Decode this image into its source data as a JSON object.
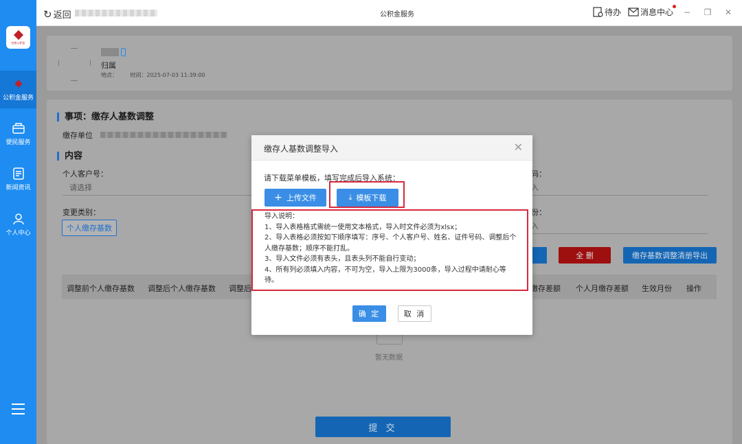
{
  "sidebar": {
    "logo_text": "住房公积金",
    "items": [
      {
        "label": "公积金服务",
        "icon": "diamond-logo-icon"
      },
      {
        "label": "便民服务",
        "icon": "box-icon"
      },
      {
        "label": "新闻资讯",
        "icon": "news-icon"
      },
      {
        "label": "个人中心",
        "icon": "user-icon"
      }
    ]
  },
  "topbar": {
    "back_label": "返回",
    "title": "公积金服务",
    "todo_label": "待办",
    "messages_label": "消息中心",
    "minimize": "−",
    "restore": "❐",
    "close": "✕"
  },
  "info_card": {
    "name": "归属",
    "location_label": "地点：",
    "time_label": "时间：2025-07-03 11:39:00"
  },
  "form": {
    "section_title": "事项：缴存人基数调整",
    "unit_label": "缴存单位",
    "content_title": "内容",
    "customer_no_label": "个人客户号：",
    "customer_no_placeholder": "请选择",
    "change_type_label": "变更类别：",
    "change_type_value": "个人缴存基数",
    "right_label_1": "码：",
    "right_value_1": "入",
    "right_label_2": "份：",
    "right_value_2": "入",
    "delete_all_label": "全 删",
    "export_label": "缴存基数调整清册导出",
    "table_headers": [
      "调整前个人缴存基数",
      "调整后个人缴存基数",
      "调整后",
      "缴存差额",
      "个人月缴存差额",
      "生效月份",
      "操作"
    ],
    "empty_text": "暂无数据",
    "submit_label": "提 交"
  },
  "modal": {
    "title": "缴存人基数调整导入",
    "hint": "请下载菜单模板，填写完成后导入系统：",
    "upload_label": "上传文件",
    "download_label": "模板下载",
    "instructions": [
      "导入说明：",
      "1、导入表格格式需统一使用文本格式，导入时文件必须为xlsx；",
      "2、导入表格必须按如下顺序填写：序号、个人客户号、姓名、证件号码、调整后个人缴存基数；顺序不能打乱。",
      "3、导入文件必须有表头，且表头列不能自行变动；",
      "4、所有列必须填入内容，不可为空，导入上限为3000条，导入过程中请耐心等待。"
    ],
    "ok_label": "确 定",
    "cancel_label": "取 消"
  },
  "colors": {
    "sidebar_bg": "#1e8cf0",
    "primary": "#3a8ee6",
    "highlight_border": "#d6283c",
    "overlay": "#9b9b9b"
  }
}
